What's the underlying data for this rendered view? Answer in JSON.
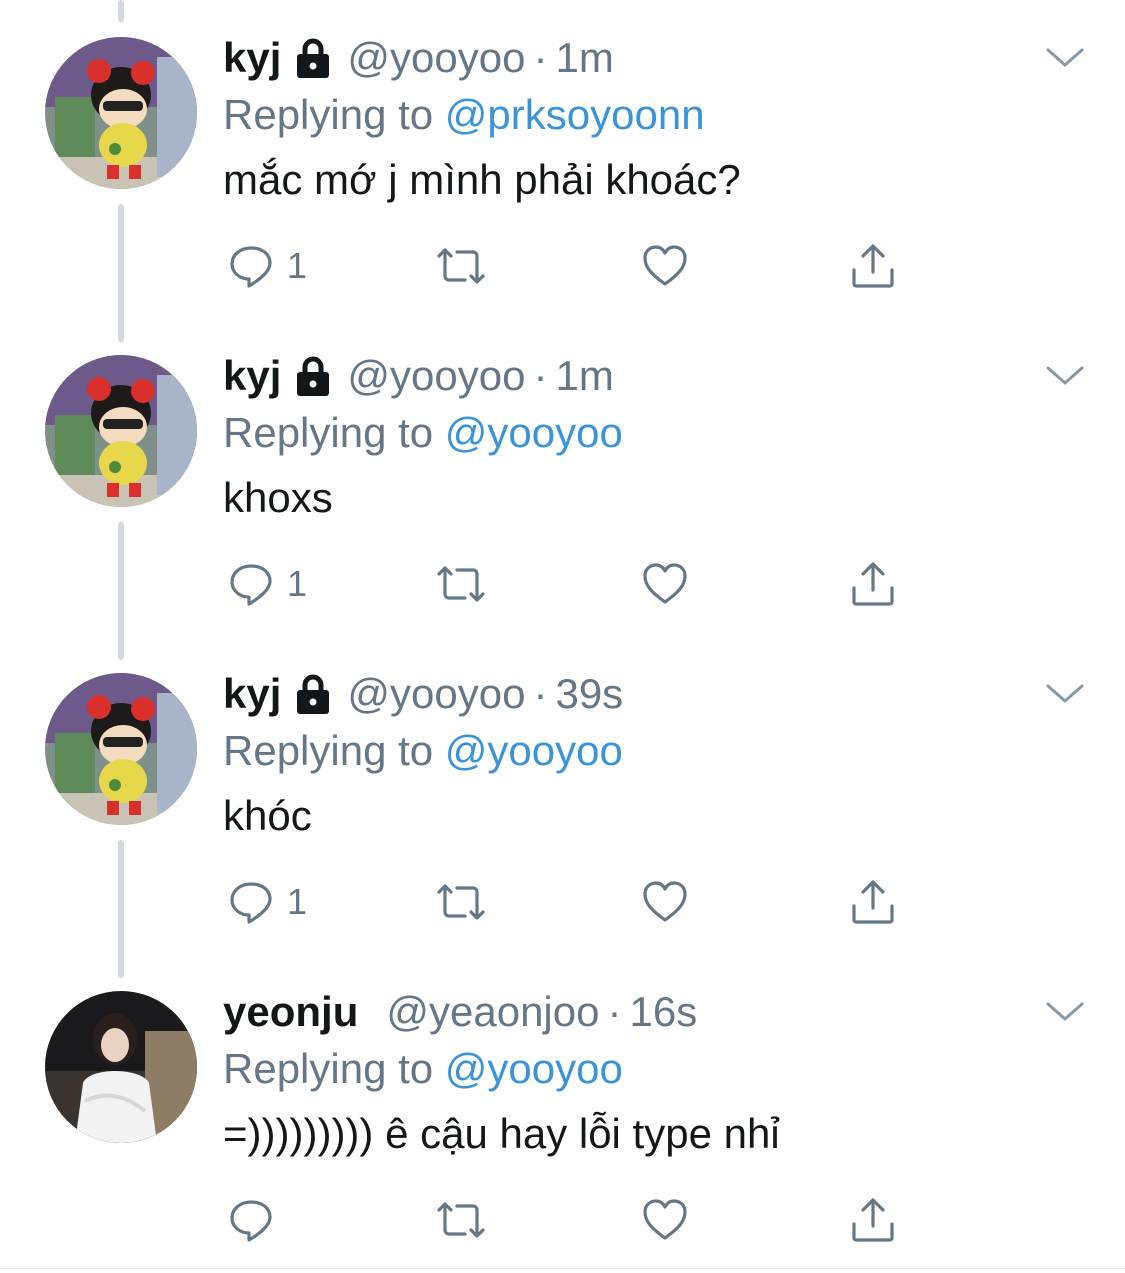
{
  "colors": {
    "accent": "#3b94d9",
    "muted": "#657786",
    "text": "#14171a",
    "thread": "#cfd9de"
  },
  "tweets": [
    {
      "name": "kyj",
      "locked": true,
      "handle": "@yooyoo",
      "dot": "·",
      "time": "1m",
      "replying_prefix": "Replying to",
      "replying_to": "@prksoyoonn",
      "text": "mắc mớ j mình phải khoác?",
      "reply_count": "1",
      "avatar": "cartoon-girl-avatar"
    },
    {
      "name": "kyj",
      "locked": true,
      "handle": "@yooyoo",
      "dot": "·",
      "time": "1m",
      "replying_prefix": "Replying to",
      "replying_to": "@yooyoo",
      "text": "khoxs",
      "reply_count": "1",
      "avatar": "cartoon-girl-avatar"
    },
    {
      "name": "kyj",
      "locked": true,
      "handle": "@yooyoo",
      "dot": "·",
      "time": "39s",
      "replying_prefix": "Replying to",
      "replying_to": "@yooyoo",
      "text": "khóc",
      "reply_count": "1",
      "avatar": "cartoon-girl-avatar"
    },
    {
      "name": "yeonju",
      "locked": false,
      "handle": "@yeaonjoo",
      "dot": "·",
      "time": "16s",
      "replying_prefix": "Replying to",
      "replying_to": "@yooyoo",
      "text": "=))))))))) ê cậu hay lỗi type nhỉ",
      "reply_count": "",
      "avatar": "photo-avatar"
    }
  ]
}
